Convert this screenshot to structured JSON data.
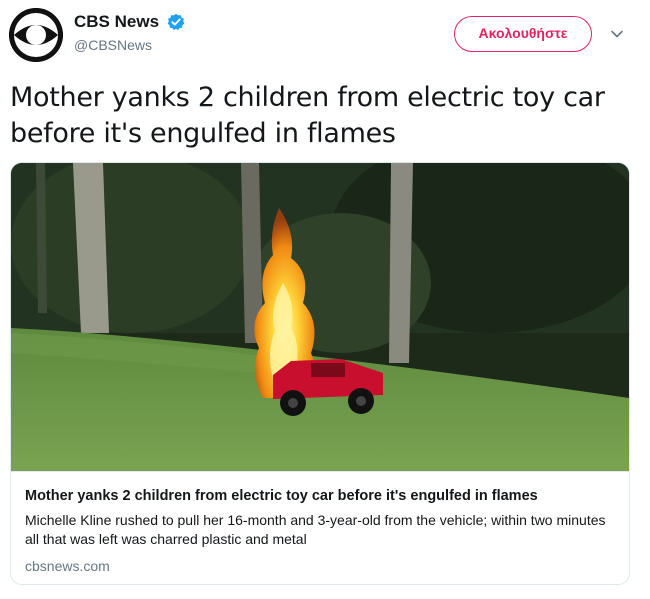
{
  "author": {
    "display_name": "CBS News",
    "handle": "@CBSNews",
    "verified": true,
    "avatar_icon": "cbs-eye-logo-icon"
  },
  "actions": {
    "follow_label": "Ακολουθήστε",
    "menu_icon": "chevron-down-icon"
  },
  "tweet": {
    "text": "Mother yanks 2 children from electric toy car before it's engulfed in flames"
  },
  "card": {
    "title": "Mother yanks 2 children from electric toy car before it's engulfed in flames",
    "description": "Michelle Kline rushed to pull her 16-month and 3-year-old from the vehicle; within two minutes all that was left was charred plastic and metal",
    "domain": "cbsnews.com"
  },
  "colors": {
    "follow_accent": "#e0245e",
    "verified_blue": "#1da1f2",
    "secondary_text": "#657786",
    "border": "#e1e8ed"
  }
}
